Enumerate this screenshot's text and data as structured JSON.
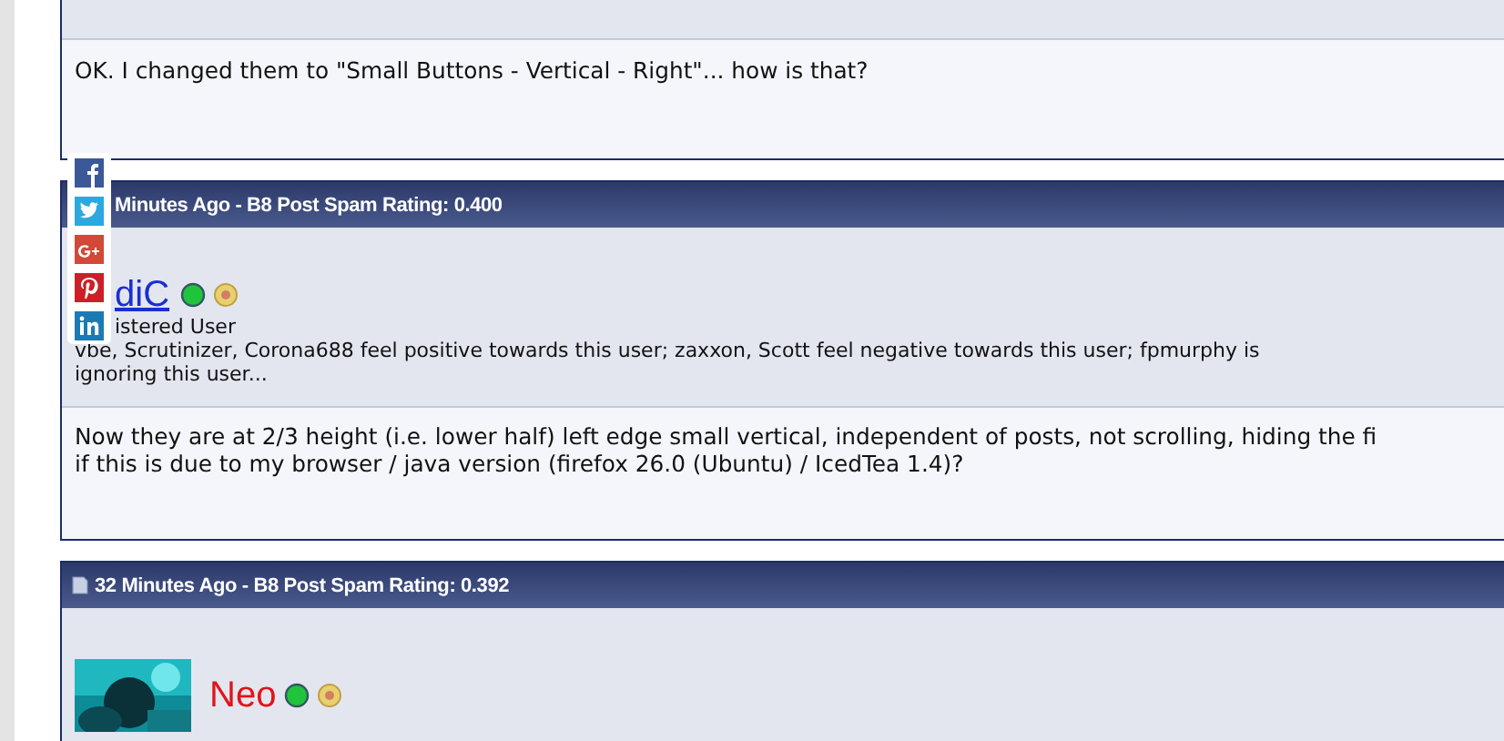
{
  "posts": [
    {
      "message_lines": [
        "OK. I changed them to \"Small Buttons - Vertical - Right\"... how is that?"
      ]
    },
    {
      "header": "Minutes Ago   - B8 Post Spam Rating: 0.400",
      "user": {
        "name": "diC",
        "color": "#1a2fd0",
        "title": "istered User",
        "online": true
      },
      "reputation_lines": [
        "vbe, Scrutinizer, Corona688 feel positive towards this user; zaxxon, Scott feel negative towards this user; fpmurphy is",
        "ignoring this user..."
      ],
      "message_lines": [
        "Now they are at 2/3 height (i.e. lower half) left edge small vertical, independent of posts, not scrolling, hiding the fi",
        "if this is due to my browser / java version (firefox 26.0 (Ubuntu) / IcedTea 1.4)?"
      ]
    },
    {
      "header": "32 Minutes Ago   - B8 Post Spam Rating: 0.392",
      "user": {
        "name": "Neo",
        "color": "#e0141a",
        "online": true
      }
    }
  ],
  "share_bar": [
    {
      "kind": "facebook"
    },
    {
      "kind": "twitter"
    },
    {
      "kind": "googleplus"
    },
    {
      "kind": "pinterest"
    },
    {
      "kind": "linkedin"
    }
  ]
}
